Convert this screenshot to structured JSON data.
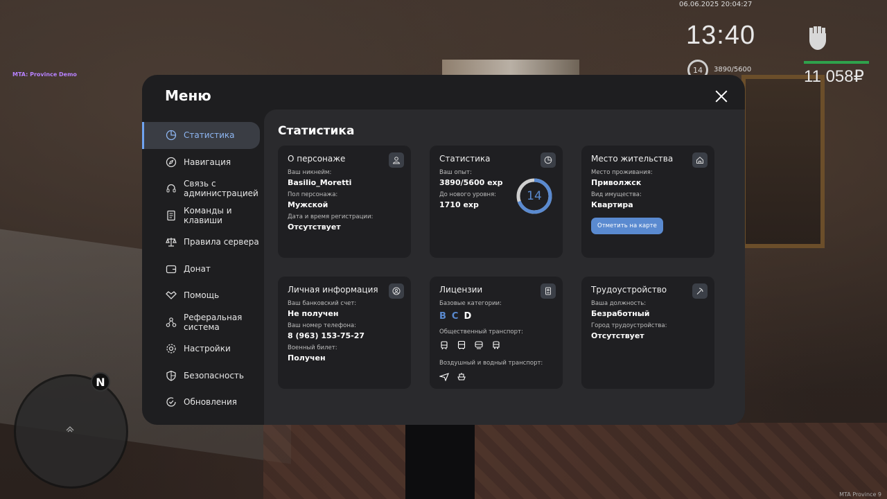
{
  "overlay": {
    "mta_label": "MTA: Province Demo",
    "datetime": "06.06.2025 20:04:27",
    "watermark": "MTA Province 9"
  },
  "hud": {
    "clock": "13:40",
    "level": "14",
    "exp": "3890/5600",
    "money": "11 058₽",
    "health_fraction": 1.0,
    "fist_icon": "fist-icon",
    "health_color": "#2fa24c"
  },
  "minimap": {
    "north_label": "N"
  },
  "menu": {
    "title": "Меню",
    "close_icon": "close-icon",
    "nav": [
      {
        "label": "Статистика",
        "icon": "pie-chart-icon",
        "active": true
      },
      {
        "label": "Навигация",
        "icon": "compass-icon"
      },
      {
        "label": "Связь с администрацией",
        "icon": "headset-icon"
      },
      {
        "label": "Команды и клавиши",
        "icon": "document-icon"
      },
      {
        "label": "Правила сервера",
        "icon": "scales-icon"
      },
      {
        "label": "Донат",
        "icon": "wallet-icon"
      },
      {
        "label": "Помощь",
        "icon": "handshake-icon"
      },
      {
        "label": "Реферальная система",
        "icon": "network-icon"
      },
      {
        "label": "Настройки",
        "icon": "gear-icon"
      },
      {
        "label": "Безопасность",
        "icon": "shield-icon"
      },
      {
        "label": "Обновления",
        "icon": "refresh-check-icon"
      }
    ],
    "accent_color": "#6fa3f0"
  },
  "content": {
    "title": "Статистика",
    "cards": {
      "character": {
        "title": "О персонаже",
        "icon": "user-icon",
        "nickname_label": "Ваш никнейм:",
        "nickname": "Basilio_Moretti",
        "gender_label": "Пол персонажа:",
        "gender": "Мужской",
        "reg_label": "Дата и время регистрации:",
        "reg": "Отсутствует"
      },
      "stats": {
        "title": "Статистика",
        "icon": "pie-chart-icon",
        "exp_label": "Ваш опыт:",
        "exp": "3890/5600 exp",
        "next_label": "До нового уровня:",
        "next": "1710 exp",
        "level": "14",
        "progress_fraction": 0.695,
        "ring_color": "#5a8ad0"
      },
      "residence": {
        "title": "Место жительства",
        "icon": "home-icon",
        "place_label": "Место проживания:",
        "place": "Приволжск",
        "type_label": "Вид имущества:",
        "type": "Квартира",
        "button": "Отметить на карте"
      },
      "personal": {
        "title": "Личная информация",
        "icon": "user-circle-icon",
        "bank_label": "Ваш банковский счет:",
        "bank": "Не получен",
        "phone_label": "Ваш номер телефона:",
        "phone": "8 (963) 153-75-27",
        "military_label": "Военный билет:",
        "military": "Получен"
      },
      "licenses": {
        "title": "Лицензии",
        "icon": "id-badge-icon",
        "base_label": "Базовые категории:",
        "categories": [
          {
            "letter": "B",
            "color": "#5a8ad0"
          },
          {
            "letter": "C",
            "color": "#5a8ad0"
          },
          {
            "letter": "D",
            "color": "#ffffff"
          }
        ],
        "public_label": "Общественный транспорт:",
        "public_icons": [
          "tram-icon",
          "bus-icon",
          "train-icon",
          "trolleybus-icon"
        ],
        "air_label": "Воздушный и водный транспорт:",
        "air_icons": [
          "plane-icon",
          "boat-icon"
        ]
      },
      "job": {
        "title": "Трудоустройство",
        "icon": "pickaxe-icon",
        "position_label": "Ваша должность:",
        "position": "Безработный",
        "city_label": "Город трудоустройства:",
        "city": "Отсутствует"
      }
    }
  }
}
